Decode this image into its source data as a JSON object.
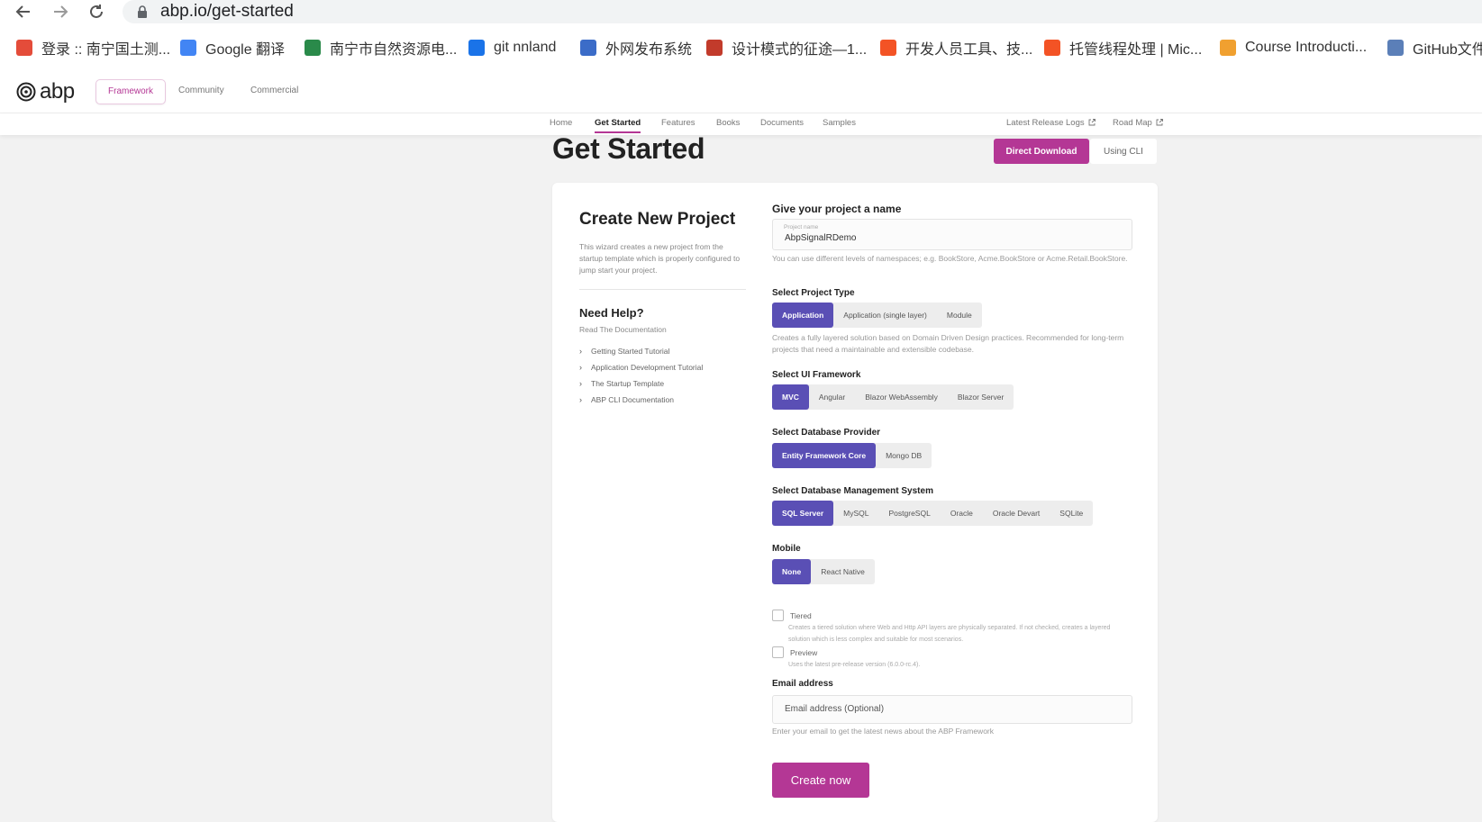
{
  "browser": {
    "url": "abp.io/get-started",
    "bookmarks": [
      {
        "label": "登录 :: 南宁国土测...",
        "icon": "git-diamond-icon",
        "color": "#e44c3a"
      },
      {
        "label": "Google 翻译",
        "icon": "google-translate-icon",
        "color": "#4285f4"
      },
      {
        "label": "南宁市自然资源电...",
        "icon": "globe-icon",
        "color": "#2a8a4a"
      },
      {
        "label": "git nnland",
        "icon": "git-lab-icon",
        "color": "#1a73e8"
      },
      {
        "label": "外网发布系统",
        "icon": "wave-icon",
        "color": "#3b6cc8"
      },
      {
        "label": "设计模式的征途—1...",
        "icon": "avatar-icon",
        "color": "#c23b2b"
      },
      {
        "label": "开发人员工具、技...",
        "icon": "microsoft-icon",
        "color": "#f35325"
      },
      {
        "label": "托管线程处理 | Mic...",
        "icon": "microsoft-icon",
        "color": "#f35325"
      },
      {
        "label": "Course Introducti...",
        "icon": "course-icon",
        "color": "#f0a030"
      },
      {
        "label": "GitHub文件",
        "icon": "document-icon",
        "color": "#5b7fb8"
      }
    ]
  },
  "header": {
    "logo_text": "abp",
    "tabs": [
      "Framework",
      "Community",
      "Commercial"
    ],
    "active_tab": "Framework"
  },
  "subnav": {
    "items": [
      "Home",
      "Get Started",
      "Features",
      "Books",
      "Documents",
      "Samples"
    ],
    "external": [
      "Latest Release Logs",
      "Road Map"
    ],
    "active": "Get Started"
  },
  "page": {
    "title": "Get Started",
    "download_button": "Direct Download",
    "cli_button": "Using CLI"
  },
  "left": {
    "title": "Create New Project",
    "description": "This wizard creates a new project from the startup template which is properly configured to jump start your project.",
    "help_title": "Need Help?",
    "help_sub": "Read The Documentation",
    "links": [
      "Getting Started Tutorial",
      "Application Development Tutorial",
      "The Startup Template",
      "ABP CLI Documentation"
    ]
  },
  "form": {
    "name_label": "Give your project a name",
    "name_float": "Project name",
    "name_value": "AbpSignalRDemo",
    "name_hint": "You can use different levels of namespaces; e.g. BookStore, Acme.BookStore or Acme.Retail.BookStore.",
    "project_type_label": "Select Project Type",
    "project_types": [
      "Application",
      "Application (single layer)",
      "Module"
    ],
    "project_type_hint": "Creates a fully layered solution based on Domain Driven Design practices. Recommended for long-term projects that need a maintainable and extensible codebase.",
    "ui_label": "Select UI Framework",
    "ui_options": [
      "MVC",
      "Angular",
      "Blazor WebAssembly",
      "Blazor Server"
    ],
    "db_label": "Select Database Provider",
    "db_options": [
      "Entity Framework Core",
      "Mongo DB"
    ],
    "dbms_label": "Select Database Management System",
    "dbms_options": [
      "SQL Server",
      "MySQL",
      "PostgreSQL",
      "Oracle",
      "Oracle Devart",
      "SQLite"
    ],
    "mobile_label": "Mobile",
    "mobile_options": [
      "None",
      "React Native"
    ],
    "tiered_label": "Tiered",
    "tiered_desc": "Creates a tiered solution where Web and Http API layers are physically separated. If not checked, creates a layered solution which is less complex and suitable for most scenarios.",
    "preview_label": "Preview",
    "preview_desc": "Uses the latest pre-release version (6.0.0-rc.4).",
    "email_label": "Email address",
    "email_placeholder": "Email address (Optional)",
    "email_hint": "Enter your email to get the latest news about the ABP Framework",
    "create_button": "Create now"
  },
  "colors": {
    "brand": "#b43795",
    "selected": "#5a4fb5"
  }
}
